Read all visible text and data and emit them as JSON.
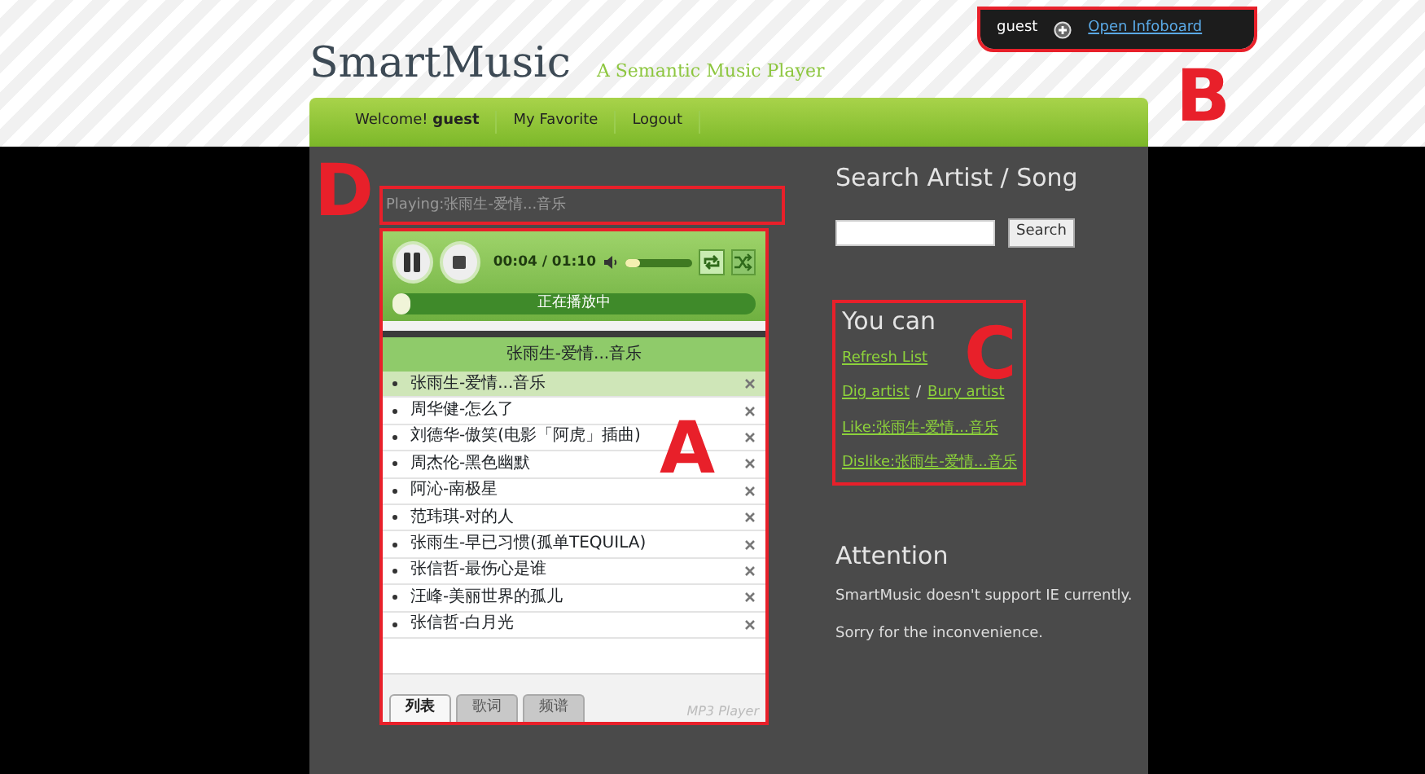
{
  "topbar": {
    "user": "guest",
    "link": "Open Infoboard"
  },
  "header": {
    "logo": "SmartMusic",
    "tagline": "A Semantic Music Player"
  },
  "nav": [
    "Welcome! **guest**",
    "My Favorite",
    "Logout"
  ],
  "now_playing": "Playing:张雨生-爱情...音乐",
  "player": {
    "playing": true,
    "time": "00:04 / 01:10",
    "volume": {
      "level": 0.22
    },
    "repeat": true,
    "shuffle": false,
    "progress": {
      "level": 0.05
    },
    "status": "正在播放中",
    "playlist_title": "张雨生-爱情...音乐",
    "songs": [
      {
        "title": "张雨生-爱情...音乐",
        "selected": true
      },
      {
        "title": "周华健-怎么了",
        "selected": false
      },
      {
        "title": "刘德华-傲笑(电影「阿虎」插曲)",
        "selected": false
      },
      {
        "title": "周杰伦-黑色幽默",
        "selected": false
      },
      {
        "title": "阿沁-南极星",
        "selected": false
      },
      {
        "title": "范玮琪-对的人",
        "selected": false
      },
      {
        "title": "张雨生-早已习惯(孤单TEQUILA)",
        "selected": false
      },
      {
        "title": "张信哲-最伤心是谁",
        "selected": false
      },
      {
        "title": "汪峰-美丽世界的孤儿",
        "selected": false
      },
      {
        "title": "张信哲-白月光",
        "selected": false
      }
    ],
    "tabs": [
      {
        "label": "列表",
        "selected": true
      },
      {
        "label": "歌词",
        "selected": false
      },
      {
        "label": "频谱",
        "selected": false
      }
    ],
    "brand": "MP3 Player"
  },
  "search": {
    "heading": "Search Artist / Song",
    "button": "Search"
  },
  "actions": {
    "heading": "You can",
    "refresh": "Refresh List",
    "dig": "Dig artist",
    "separator": "/",
    "bury": "Bury artist",
    "like": "Like:张雨生-爱情...音乐",
    "dislike": "Dislike:张雨生-爱情...音乐"
  },
  "attention": {
    "heading": "Attention",
    "lines": [
      "SmartMusic doesn't support IE currently.",
      "Sorry for the inconvenience."
    ]
  },
  "annotations": [
    {
      "label": "B"
    },
    {
      "label": "D"
    },
    {
      "label": "C"
    },
    {
      "label": "A"
    }
  ]
}
